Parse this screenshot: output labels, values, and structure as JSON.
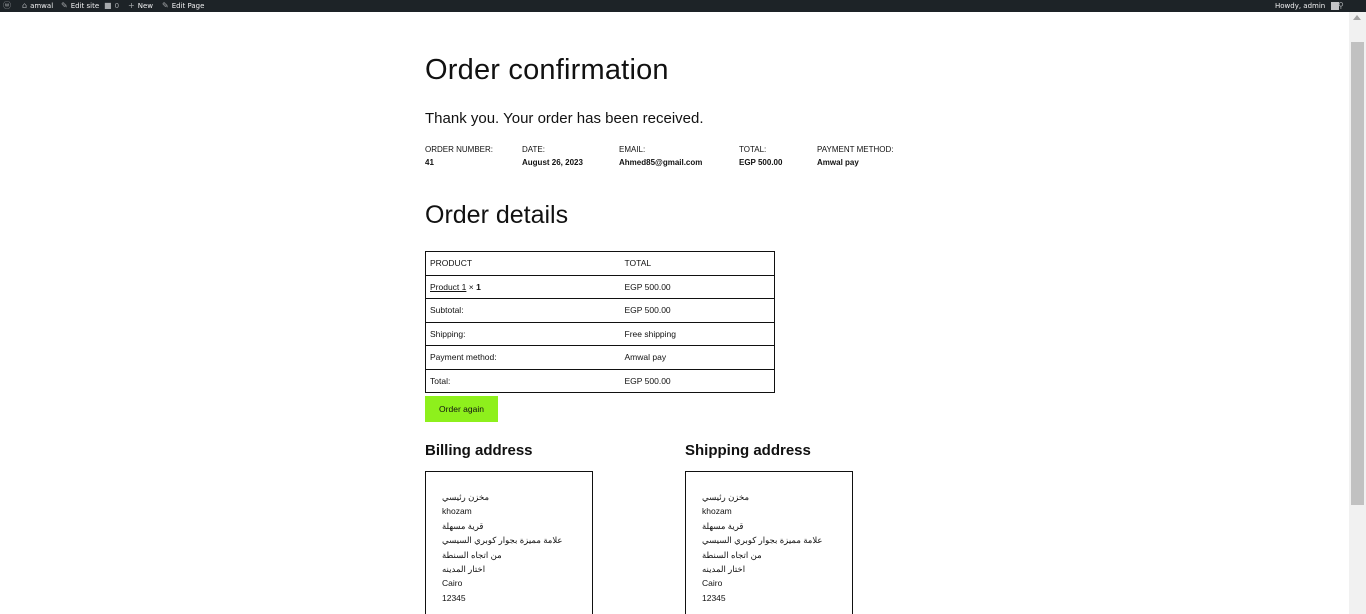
{
  "adminbar": {
    "site_name": "amwal",
    "edit_site": "Edit site",
    "comments_count": "0",
    "new_label": "New",
    "edit_page": "Edit Page",
    "howdy": "Howdy, admin"
  },
  "page": {
    "title": "Order confirmation",
    "thank_you": "Thank you. Your order has been received."
  },
  "overview": {
    "order_number_label": "ORDER NUMBER:",
    "order_number": "41",
    "date_label": "DATE:",
    "date": "August 26, 2023",
    "email_label": "EMAIL:",
    "email": "Ahmed85@gmail.com",
    "total_label": "TOTAL:",
    "total": "EGP 500.00",
    "payment_label": "PAYMENT METHOD:",
    "payment": "Amwal pay"
  },
  "order_details": {
    "title": "Order details",
    "header_product": "PRODUCT",
    "header_total": "TOTAL",
    "product_name": "Product 1",
    "product_times": " × ",
    "product_qty": "1",
    "product_total": "EGP 500.00",
    "rows": [
      {
        "label": "Subtotal:",
        "value": "EGP 500.00"
      },
      {
        "label": "Shipping:",
        "value": "Free shipping"
      },
      {
        "label": "Payment method:",
        "value": "Amwal pay"
      },
      {
        "label": "Total:",
        "value": "EGP 500.00"
      }
    ],
    "order_again": "Order again"
  },
  "billing": {
    "title": "Billing address",
    "lines": [
      "مخزن رئيسي",
      "khozam",
      "قرية مسهلة",
      "علامة مميزة بجوار كوبري السيسي",
      "من اتجاه السنطة",
      "اختار المدينه",
      "Cairo",
      "12345"
    ]
  },
  "shipping": {
    "title": "Shipping address",
    "lines": [
      "مخزن رئيسي",
      "khozam",
      "قرية مسهلة",
      "علامة مميزة بجوار كوبري السيسي",
      "من اتجاه السنطة",
      "اختار المدينه",
      "Cairo",
      "12345"
    ]
  },
  "colors": {
    "adminbar_bg": "#1d2327",
    "button_bg": "#8ef01c"
  }
}
